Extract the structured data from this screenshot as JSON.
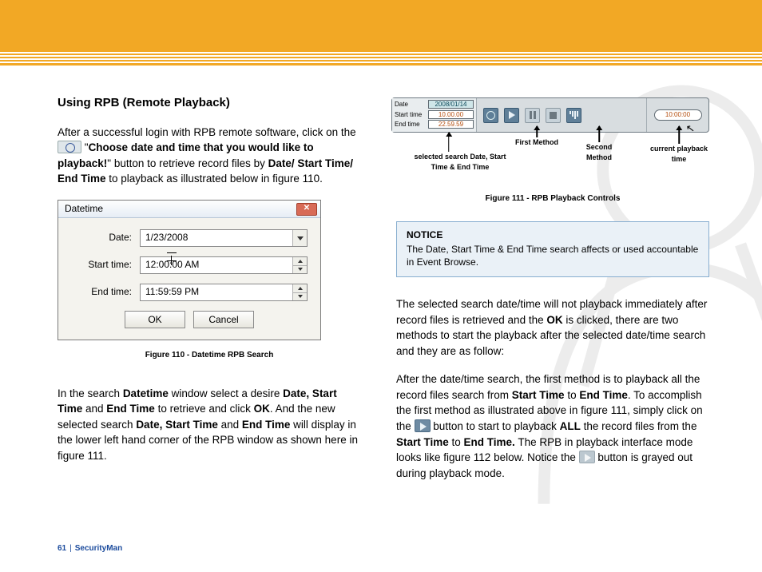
{
  "header": {
    "title": "Using RPB (Remote Playback)"
  },
  "left": {
    "p1a": "After a successful login with RPB remote software, click on the ",
    "p1b": " \"",
    "p1c": "Choose date and time that you would like to playback!",
    "p1d": "\" button to retrieve record files by ",
    "p1e": "Date/ Start Time/ End Time",
    "p1f": " to playback as illustrated below in figure 110.",
    "dlg": {
      "title": "Datetime",
      "date_label": "Date:",
      "date_value": "1/23/2008",
      "start_label": "Start time:",
      "start_value": "12:00:00 AM",
      "end_label": "End time:",
      "end_value": "11:59:59 PM",
      "ok": "OK",
      "cancel": "Cancel"
    },
    "fig110": "Figure 110 - Datetime RPB Search",
    "p2a": "In the search ",
    "p2b": "Datetime",
    "p2c": " window select a desire ",
    "p2d": "Date, Start Time",
    "p2e": " and ",
    "p2f": "End Time",
    "p2g": " to retrieve and click ",
    "p2h": "OK",
    "p2i": ". And the new selected search ",
    "p2j": "Date, Start Time",
    "p2k": " and ",
    "p2l": "End Time",
    "p2m": " will display in the lower left hand corner of the RPB window as shown here in figure 111."
  },
  "right": {
    "pbc": {
      "date_label": "Date",
      "date_value": "2008/01/14",
      "start_label": "Start time",
      "start_value": "10.00.00",
      "end_label": "End time",
      "end_value": "22.59.59",
      "current": "10:00:00"
    },
    "annots": {
      "a1": "selected search Date, Start Time & End Time",
      "a2": "First Method",
      "a3": "Second Method",
      "a4": "current playback time"
    },
    "fig111": "Figure 111 - RPB Playback Controls",
    "notice_title": "NOTICE",
    "notice_body": "The Date, Start Time & End Time search affects or used accountable in Event Browse.",
    "p1a": "The selected search date/time will not playback immediately after record files is retrieved and the ",
    "p1b": "OK",
    "p1c": " is clicked, there are two methods to start the playback after the selected date/time search and they are as follow:",
    "p2a": "After the date/time search, the first method is to playback all the record files search from ",
    "p2b": "Start Time",
    "p2c": " to ",
    "p2d": "End Time",
    "p2e": ". To accomplish the first method as illustrated above in figure 111, simply click on the ",
    "p2f": " button to start to playback ",
    "p2g": "ALL",
    "p2h": " the record files from the ",
    "p2i": "Start Time",
    "p2j": " to ",
    "p2k": "End Time.",
    "p2l": " The RPB in playback interface mode looks like figure 112 below.  Notice the ",
    "p2m": " button is grayed out during playback mode."
  },
  "footer": {
    "page": "61",
    "brand": "SecurityMan"
  }
}
